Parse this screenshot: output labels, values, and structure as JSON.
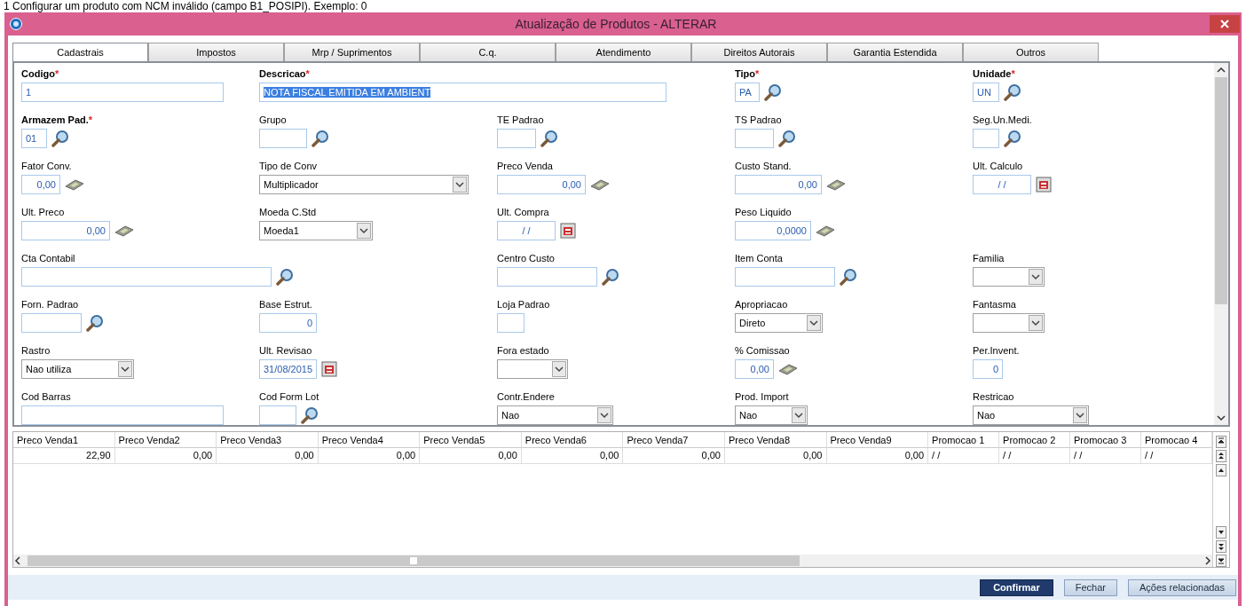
{
  "caption": "1 Configurar um produto com NCM inválido (campo B1_POSIPI). Exemplo: 0",
  "window": {
    "title": "Atualização de Produtos - ALTERAR"
  },
  "tabs": [
    {
      "label": "Cadastrais",
      "selected": true
    },
    {
      "label": "Impostos",
      "selected": false
    },
    {
      "label": "Mrp / Suprimentos",
      "selected": false
    },
    {
      "label": "C.q.",
      "selected": false
    },
    {
      "label": "Atendimento",
      "selected": false
    },
    {
      "label": "Direitos Autorais",
      "selected": false
    },
    {
      "label": "Garantia Estendida",
      "selected": false
    },
    {
      "label": "Outros",
      "selected": false
    }
  ],
  "form": {
    "fields": [
      {
        "label": "Codigo",
        "required": true,
        "required_mark": "*",
        "kind": "text",
        "value": "1"
      },
      {
        "label": "Descricao",
        "required": true,
        "required_mark": "*",
        "kind": "text",
        "value": "NOTA FISCAL EMITIDA EM AMBIENT",
        "text_selected": true
      },
      {
        "label": "Tipo",
        "required": true,
        "required_mark": "*",
        "kind": "lookup",
        "value": "PA"
      },
      {
        "label": "Unidade",
        "required": true,
        "required_mark": "*",
        "kind": "lookup",
        "value": "UN"
      },
      {
        "label": "Armazem Pad.",
        "required": true,
        "required_mark": "*",
        "kind": "lookup",
        "value": "01"
      },
      {
        "label": "Grupo",
        "required": false,
        "kind": "lookup"
      },
      {
        "label": "TE Padrao",
        "required": false,
        "kind": "lookup"
      },
      {
        "label": "TS Padrao",
        "required": false,
        "kind": "lookup"
      },
      {
        "label": "Seg.Un.Medi.",
        "required": false,
        "kind": "lookup"
      },
      {
        "label": "Fator Conv.",
        "required": false,
        "kind": "money",
        "value": "0,00"
      },
      {
        "label": "Tipo de Conv",
        "required": false,
        "kind": "select",
        "value": "Multiplicador"
      },
      {
        "label": "Preco Venda",
        "required": false,
        "kind": "money",
        "value": "0,00"
      },
      {
        "label": "Custo Stand.",
        "required": false,
        "kind": "money",
        "value": "0,00"
      },
      {
        "label": "Ult. Calculo",
        "required": false,
        "kind": "date",
        "value": "/ /"
      },
      {
        "label": "Ult. Preco",
        "required": false,
        "kind": "money",
        "value": "0,00"
      },
      {
        "label": "Moeda C.Std",
        "required": false,
        "kind": "select",
        "value": "Moeda1"
      },
      {
        "label": "Ult. Compra",
        "required": false,
        "kind": "date",
        "value": "/ /"
      },
      {
        "label": "Peso Liquido",
        "required": false,
        "kind": "money",
        "value": "0,0000"
      },
      {
        "label": "Cta Contabil",
        "required": false,
        "kind": "lookup"
      },
      {
        "label": "Centro Custo",
        "required": false,
        "kind": "lookup"
      },
      {
        "label": "Item Conta",
        "required": false,
        "kind": "lookup"
      },
      {
        "label": "Familia",
        "required": false,
        "kind": "select"
      },
      {
        "label": "Forn. Padrao",
        "required": false,
        "kind": "lookup"
      },
      {
        "label": "Base Estrut.",
        "required": false,
        "kind": "number",
        "value": "0"
      },
      {
        "label": "Loja Padrao",
        "required": false,
        "kind": "text"
      },
      {
        "label": "Apropriacao",
        "required": false,
        "kind": "select",
        "value": "Direto"
      },
      {
        "label": "Fantasma",
        "required": false,
        "kind": "select"
      },
      {
        "label": "Rastro",
        "required": false,
        "kind": "select",
        "value": "Nao utiliza"
      },
      {
        "label": "Ult. Revisao",
        "required": false,
        "kind": "date",
        "value": "31/08/2015"
      },
      {
        "label": "Fora estado",
        "required": false,
        "kind": "select"
      },
      {
        "label": "% Comissao",
        "required": false,
        "kind": "money",
        "value": "0,00"
      },
      {
        "label": "Per.Invent.",
        "required": false,
        "kind": "number",
        "value": "0"
      },
      {
        "label": "Cod Barras",
        "required": false,
        "kind": "text"
      },
      {
        "label": "Cod Form Lot",
        "required": false,
        "kind": "lookup"
      },
      {
        "label": "Contr.Endere",
        "required": false,
        "kind": "select",
        "value": "Nao"
      },
      {
        "label": "Prod. Import",
        "required": false,
        "kind": "select",
        "value": "Nao"
      },
      {
        "label": "Restricao",
        "required": false,
        "kind": "select",
        "value": "Nao"
      }
    ]
  },
  "grid": {
    "columns": [
      {
        "label": "Preco Venda1",
        "kind": "price"
      },
      {
        "label": "Preco Venda2",
        "kind": "price"
      },
      {
        "label": "Preco Venda3",
        "kind": "price"
      },
      {
        "label": "Preco Venda4",
        "kind": "price"
      },
      {
        "label": "Preco Venda5",
        "kind": "price"
      },
      {
        "label": "Preco Venda6",
        "kind": "price"
      },
      {
        "label": "Preco Venda7",
        "kind": "price"
      },
      {
        "label": "Preco Venda8",
        "kind": "price"
      },
      {
        "label": "Preco Venda9",
        "kind": "price"
      },
      {
        "label": "Promocao 1",
        "kind": "date"
      },
      {
        "label": "Promocao 2",
        "kind": "date"
      },
      {
        "label": "Promocao 3",
        "kind": "date"
      },
      {
        "label": "Promocao 4",
        "kind": "date"
      }
    ],
    "rows": [
      [
        "22,90",
        "0,00",
        "0,00",
        "0,00",
        "0,00",
        "0,00",
        "0,00",
        "0,00",
        "0,00",
        "/ /",
        "/ /",
        "/ /",
        "/ /"
      ]
    ]
  },
  "buttons": [
    {
      "label": "Confirmar",
      "kind": "primary"
    },
    {
      "label": "Fechar",
      "kind": "secondary"
    },
    {
      "label": "Ações relacionadas",
      "kind": "secondary"
    }
  ]
}
